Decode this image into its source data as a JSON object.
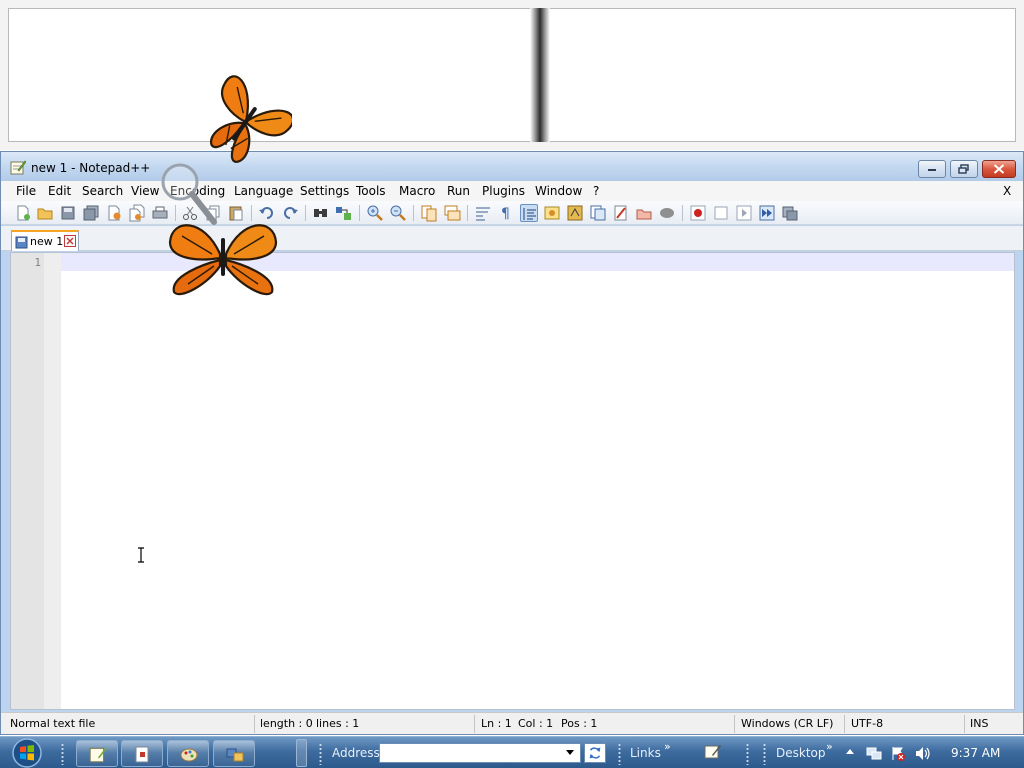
{
  "window": {
    "title": "new 1 - Notepad++",
    "menu_close": "X"
  },
  "menu": {
    "items": [
      "File",
      "Edit",
      "Search",
      "View",
      "Encoding",
      "Language",
      "Settings",
      "Tools",
      "Macro",
      "Run",
      "Plugins",
      "Window",
      "?"
    ]
  },
  "toolbar": {
    "icons": [
      "new-file-icon",
      "open-file-icon",
      "save-icon",
      "save-all-icon",
      "close-icon",
      "close-all-icon",
      "print-icon",
      "cut-icon",
      "copy-icon",
      "paste-icon",
      "undo-icon",
      "redo-icon",
      "find-icon",
      "replace-icon",
      "zoom-in-icon",
      "zoom-out-icon",
      "sync-vertical-icon",
      "sync-horizontal-icon",
      "word-wrap-icon",
      "show-all-chars-icon",
      "indent-guide-icon",
      "user-language-icon",
      "doc-map-icon",
      "function-list-icon",
      "folder-workspace-icon",
      "monitoring-icon",
      "record-macro-icon",
      "stop-macro-icon",
      "play-macro-icon",
      "run-macro-multiple-icon",
      "save-macro-icon"
    ]
  },
  "tabs": [
    {
      "label": "new 1",
      "active": true
    }
  ],
  "editor": {
    "line_numbers": [
      "1"
    ],
    "current_line_color": "#e8e8ff"
  },
  "status": {
    "file_type": "Normal text file",
    "length": "length : 0",
    "lines": "lines : 1",
    "ln": "Ln : 1",
    "col": "Col : 1",
    "pos": "Pos : 1",
    "eol": "Windows (CR LF)",
    "encoding": "UTF-8",
    "mode": "INS"
  },
  "taskbar": {
    "address_label": "Address",
    "address_value": "",
    "links_label": "Links",
    "chevron": "»",
    "desktop_label": "Desktop",
    "clock": "9:37 AM"
  },
  "colors": {
    "accent_tab": "#f5a623",
    "taskbar": "#3e6c9f",
    "close_button": "#d9583f"
  }
}
